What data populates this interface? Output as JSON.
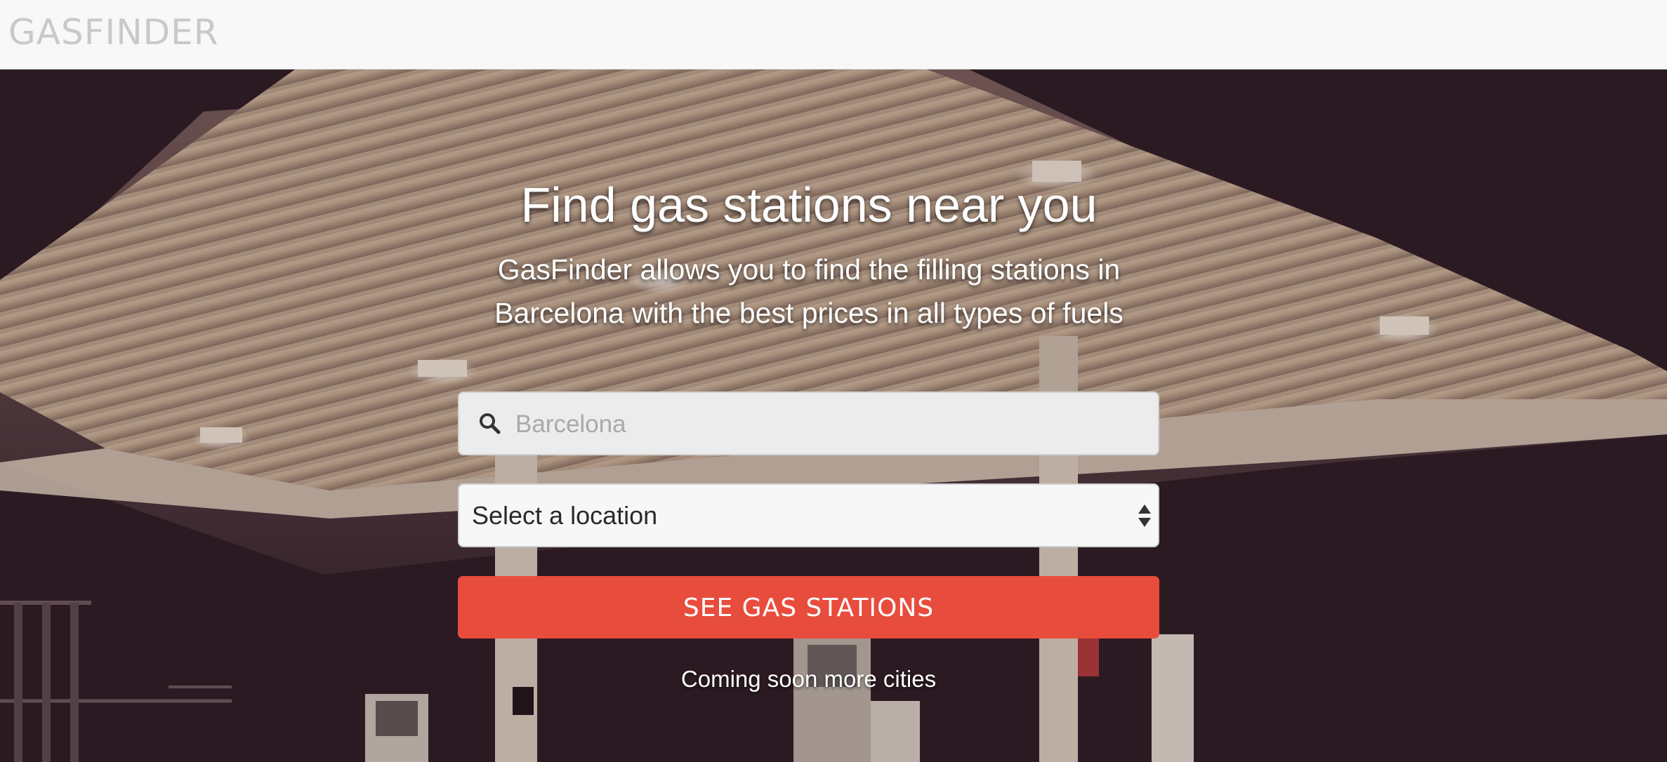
{
  "brand": {
    "name": "GASFINDER"
  },
  "hero": {
    "headline": "Find gas stations near you",
    "description": "GasFinder allows you to find the filling stations in Barcelona with the best prices in all types of fuels",
    "background_image": "gas-station-canopy-night-photo"
  },
  "search": {
    "placeholder": "Barcelona",
    "value": "",
    "icon": "search-icon"
  },
  "location_select": {
    "selected": "Select a location",
    "icon": "updown-arrows-icon"
  },
  "cta": {
    "label": "SEE GAS STATIONS"
  },
  "footer_note": "Coming soon more cities",
  "colors": {
    "navbar_bg": "#f8f8f8",
    "brand_text": "#c9c9c9",
    "button_accent": "#e84c3d",
    "hero_text": "#ffffff"
  }
}
